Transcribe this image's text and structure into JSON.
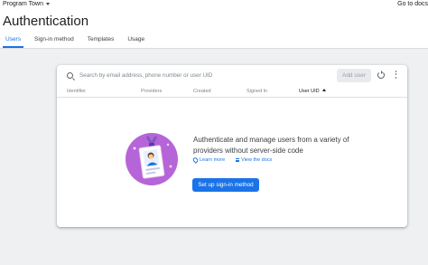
{
  "topbar": {
    "project_name": "Program Town",
    "docs_link": "Go to docs"
  },
  "header": {
    "title": "Authentication",
    "tabs": [
      {
        "label": "Users",
        "active": true
      },
      {
        "label": "Sign-in method",
        "active": false
      },
      {
        "label": "Templates",
        "active": false
      },
      {
        "label": "Usage",
        "active": false
      }
    ]
  },
  "users_table": {
    "search_placeholder": "Search by email address, phone number or user UID",
    "add_user_label": "Add user",
    "columns": [
      "Identifier",
      "Providers",
      "Created",
      "Signed In",
      "User UID"
    ],
    "sorted_column": "User UID",
    "sort_direction": "ascending"
  },
  "empty_state": {
    "title": "Authenticate and manage users from a variety of providers without server-side code",
    "learn_more_label": "Learn more",
    "view_docs_label": "View the docs",
    "setup_button_label": "Set up sign-in method"
  },
  "colors": {
    "accent": "#1a73e8",
    "illustration_purple": "#b565d8",
    "page_background": "#eef0f2"
  },
  "icons": [
    "chevron-down-icon",
    "search-icon",
    "refresh-icon",
    "more-vert-icon",
    "sort-arrow-icon",
    "location-pin-icon",
    "document-icon",
    "id-badge-illustration"
  ]
}
